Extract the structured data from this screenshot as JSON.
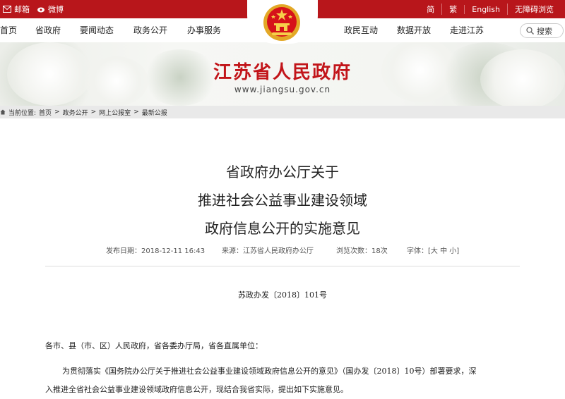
{
  "topbar": {
    "mail_label": "邮箱",
    "weibo_label": "微博",
    "simplified": "简",
    "traditional": "繁",
    "english": "English",
    "accessibility": "无障碍浏览"
  },
  "nav": {
    "items": [
      "首页",
      "省政府",
      "要闻动态",
      "政务公开",
      "办事服务",
      "政民互动",
      "数据开放",
      "走进江苏"
    ],
    "search_label": "搜索"
  },
  "banner": {
    "title": "江苏省人民政府",
    "url": "www.jiangsu.gov.cn"
  },
  "breadcrumb": {
    "prefix": "当前位置:",
    "items": [
      "首页",
      "政务公开",
      "网上公报室",
      "最新公报"
    ],
    "separator": ">"
  },
  "article": {
    "title_lines": [
      "省政府办公厅关于",
      "推进社会公益事业建设领域",
      "政府信息公开的实施意见"
    ],
    "publish_date": "发布日期：2018-12-11 16:43",
    "source": "来源：江苏省人民政府办公厅",
    "views": "浏览次数：18次",
    "font_size_label": "字体：[大 中 小]",
    "doc_number": "苏政办发〔2018〕101号",
    "salutation": "各市、县（市、区）人民政府，省各委办厅局，省各直属单位：",
    "paragraph_line1": "为贯彻落实《国务院办公厅关于推进社会公益事业建设领域政府信息公开的意见》（国办发〔2018〕10号）部署要求，深",
    "paragraph_line2": "入推进全省社会公益事业建设领域政府信息公开，现结合我省实际，提出如下实施意见。"
  },
  "colors": {
    "brand_red": "#b8161b",
    "title_red": "#c2151a",
    "emblem_gold": "#f2c14e"
  }
}
